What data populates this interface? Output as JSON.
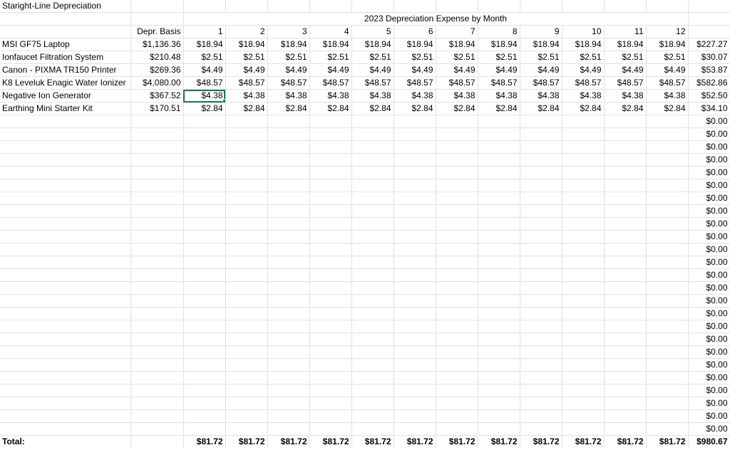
{
  "title": "Staright-Line Depreciation",
  "header_span": "2023 Depreciation Expense by Month",
  "basis_label": "Depr. Basis",
  "months": [
    "1",
    "2",
    "3",
    "4",
    "5",
    "6",
    "7",
    "8",
    "9",
    "10",
    "11",
    "12"
  ],
  "assets": [
    {
      "name": "MSI GF75 Laptop",
      "basis": "$1,136.36",
      "monthly": "$18.94",
      "total": "$227.27"
    },
    {
      "name": "Ionfaucet Filtration System",
      "basis": "$210.48",
      "monthly": "$2.51",
      "total": "$30.07"
    },
    {
      "name": "Canon - PIXMA TR150 Printer",
      "basis": "$269.36",
      "monthly": "$4.49",
      "total": "$53.87"
    },
    {
      "name": "K8 Leveluk Enagic Water Ionizer",
      "basis": "$4,080.00",
      "monthly": "$48.57",
      "total": "$582.86"
    },
    {
      "name": "Negative Ion Generator",
      "basis": "$367.52",
      "monthly": "$4.38",
      "total": "$52.50"
    },
    {
      "name": "Earthing Mini Starter Kit",
      "basis": "$170.51",
      "monthly": "$2.84",
      "total": "$34.10"
    }
  ],
  "empty_total": "$0.00",
  "empty_row_count": 25,
  "total_row": {
    "label": "Total:",
    "monthly": [
      "$81.72",
      "$81.72",
      "$81.72",
      "$81.72",
      "$81.72",
      "$81.72",
      "$81.72",
      "$81.72",
      "$81.72",
      "$81.72",
      "$81.72",
      "$81.72"
    ],
    "grand": "$980.67"
  },
  "selection": {
    "row": 4,
    "col": 1
  },
  "accent_color": "#217346"
}
